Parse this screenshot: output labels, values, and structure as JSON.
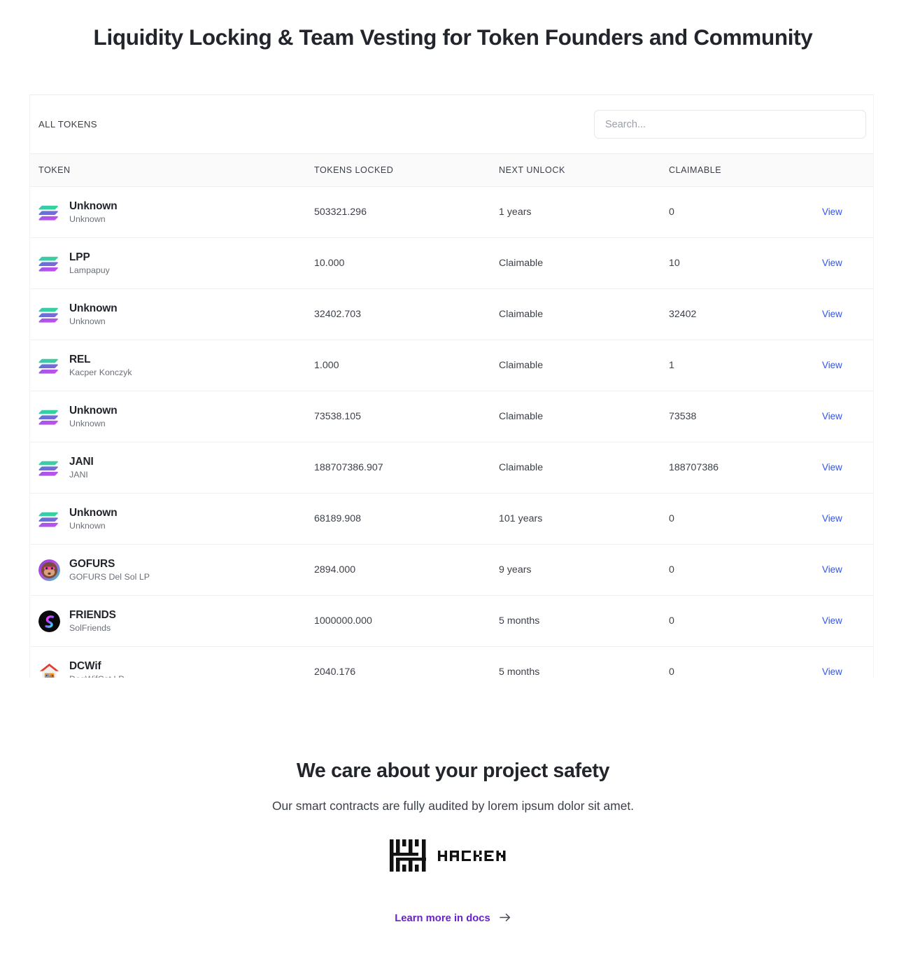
{
  "hero": {
    "title": "Liquidity Locking & Team Vesting for Token Founders and Community"
  },
  "toolbar": {
    "all_tokens_label": "ALL TOKENS",
    "search_placeholder": "Search...",
    "search_value": ""
  },
  "table": {
    "columns": [
      "TOKEN",
      "TOKENS LOCKED",
      "NEXT UNLOCK",
      "CLAIMABLE",
      ""
    ],
    "action_label": "View",
    "rows": [
      {
        "symbol": "Unknown",
        "name": "Unknown",
        "icon": "solana-icon",
        "tokens_locked": "503321.296",
        "next_unlock": "1 years",
        "claimable": "0",
        "action": "View"
      },
      {
        "symbol": "LPP",
        "name": "Lampapuy",
        "icon": "solana-icon",
        "tokens_locked": "10.000",
        "next_unlock": "Claimable",
        "claimable": "10",
        "action": "View"
      },
      {
        "symbol": "Unknown",
        "name": "Unknown",
        "icon": "solana-icon",
        "tokens_locked": "32402.703",
        "next_unlock": "Claimable",
        "claimable": "32402",
        "action": "View"
      },
      {
        "symbol": "REL",
        "name": "Kacper Konczyk",
        "icon": "solana-icon",
        "tokens_locked": "1.000",
        "next_unlock": "Claimable",
        "claimable": "1",
        "action": "View"
      },
      {
        "symbol": "Unknown",
        "name": "Unknown",
        "icon": "solana-icon",
        "tokens_locked": "73538.105",
        "next_unlock": "Claimable",
        "claimable": "73538",
        "action": "View"
      },
      {
        "symbol": "JANI",
        "name": "JANI",
        "icon": "solana-icon",
        "tokens_locked": "188707386.907",
        "next_unlock": "Claimable",
        "claimable": "188707386",
        "action": "View"
      },
      {
        "symbol": "Unknown",
        "name": "Unknown",
        "icon": "solana-icon",
        "tokens_locked": "68189.908",
        "next_unlock": "101 years",
        "claimable": "0",
        "action": "View"
      },
      {
        "symbol": "GOFURS",
        "name": "GOFURS Del Sol LP",
        "icon": "gofurs-avatar-icon",
        "tokens_locked": "2894.000",
        "next_unlock": "9 years",
        "claimable": "0",
        "action": "View"
      },
      {
        "symbol": "FRIENDS",
        "name": "SolFriends",
        "icon": "solfriends-avatar-icon",
        "tokens_locked": "1000000.000",
        "next_unlock": "5 months",
        "claimable": "0",
        "action": "View"
      },
      {
        "symbol": "DCWif",
        "name": "DogWifCat LP",
        "icon": "dcwif-avatar-icon",
        "tokens_locked": "2040.176",
        "next_unlock": "5 months",
        "claimable": "0",
        "action": "View"
      }
    ]
  },
  "safety": {
    "title": "We care about your project safety",
    "subtitle": "Our smart contracts are fully audited by lorem ipsum dolor sit amet.",
    "auditor": "HACKEN",
    "docs_link": "Learn more in docs"
  },
  "colors": {
    "link_blue": "#2f54eb",
    "docs_purple": "#6b21c8",
    "text_primary": "#22252b",
    "text_secondary": "#6b7078",
    "border": "#f0f0f3",
    "header_bg": "#fafafb"
  }
}
